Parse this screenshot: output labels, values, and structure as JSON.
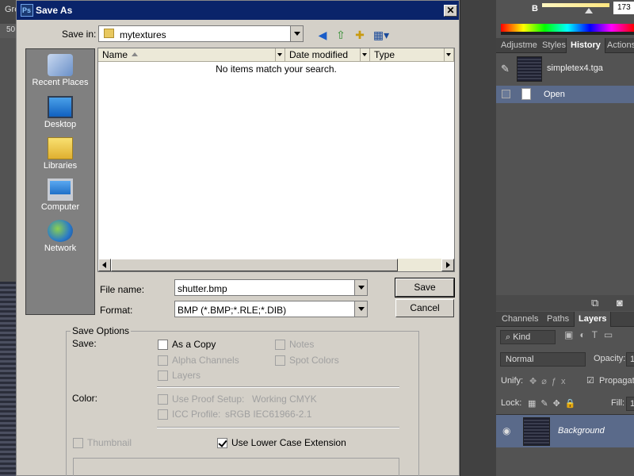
{
  "photoshop": {
    "doc_tab_label": "Gre",
    "ruler_label": "50",
    "color_panel": {
      "channel_label": "B",
      "channel_value": "173"
    },
    "history_tabs": [
      "Adjustme",
      "Styles",
      "History",
      "Actions"
    ],
    "history_snapshot": "simpletex4.tga",
    "history_states": [
      "Open"
    ],
    "layers_tabs": [
      "Channels",
      "Paths",
      "Layers"
    ],
    "kind_filter": "Kind",
    "blend_mode": "Normal",
    "opacity_label": "Opacity:",
    "opacity_value": "1",
    "unify_label": "Unify:",
    "propagate_label": "Propagate",
    "lock_label": "Lock:",
    "fill_label": "Fill:",
    "fill_value": "1",
    "layers": [
      "Background"
    ]
  },
  "dialog": {
    "title": "Save As",
    "app_badge": "Ps",
    "save_in_label": "Save in:",
    "save_in_value": "mytextures",
    "places": [
      "Recent Places",
      "Desktop",
      "Libraries",
      "Computer",
      "Network"
    ],
    "columns": [
      "Name",
      "Date modified",
      "Type"
    ],
    "empty_message": "No items match your search.",
    "file_name_label": "File name:",
    "file_name_value": "shutter.bmp",
    "format_label": "Format:",
    "format_value": "BMP (*.BMP;*.RLE;*.DIB)",
    "save_button": "Save",
    "cancel_button": "Cancel",
    "save_options": {
      "title": "Save Options",
      "save_label": "Save:",
      "as_a_copy": "As a Copy",
      "notes": "Notes",
      "alpha_channels": "Alpha Channels",
      "spot_colors": "Spot Colors",
      "layers": "Layers",
      "color_label": "Color:",
      "use_proof_setup": "Use Proof Setup:",
      "proof_profile": "Working CMYK",
      "icc_profile": "ICC Profile:",
      "icc_value": "sRGB IEC61966-2.1",
      "thumbnail": "Thumbnail",
      "lower_case_ext": "Use Lower Case Extension"
    }
  }
}
